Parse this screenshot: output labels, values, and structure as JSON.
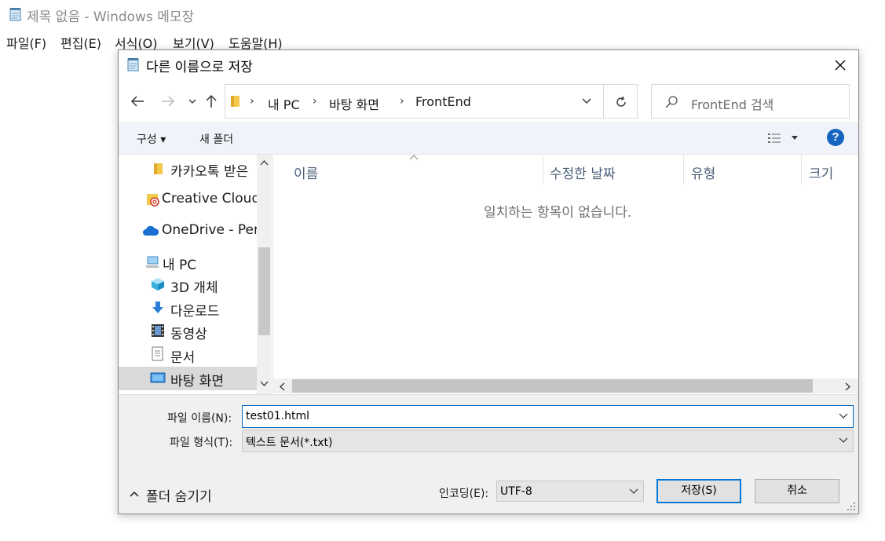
{
  "notepad": {
    "title": "제목 없음 - Windows 메모장",
    "menu": [
      "파일(F)",
      "편집(E)",
      "서식(O)",
      "보기(V)",
      "도움말(H)"
    ]
  },
  "dialog": {
    "title": "다른 이름으로 저장",
    "address": {
      "segments": [
        "내 PC",
        "바탕 화면",
        "FrontEnd"
      ]
    },
    "search_placeholder": "FrontEnd 검색",
    "toolbar": {
      "organize": "구성 ▾",
      "new_folder": "새 폴더",
      "help": "?"
    },
    "nav_items": [
      "카카오톡 받은",
      "Creative Cloud",
      "OneDrive - Per",
      "내 PC",
      "3D 개체",
      "다운로드",
      "동영상",
      "문서",
      "바탕 화면"
    ],
    "nav_selected": "바탕 화면",
    "columns": [
      "이름",
      "수정한 날짜",
      "유형",
      "크기"
    ],
    "empty_message": "일치하는 항목이 없습니다.",
    "filename_label": "파일 이름(N):",
    "filename_value": "test01.html",
    "filetype_label": "파일 형식(T):",
    "filetype_value": "텍스트 문서(*.txt)",
    "hide_folders": "폴더 숨기기",
    "encoding_label": "인코딩(E):",
    "encoding_value": "UTF-8",
    "save_button": "저장(S)",
    "cancel_button": "취소"
  },
  "colors": {
    "accent": "#0078d7",
    "selection": "#d9d9d9",
    "help": "#1565c0"
  }
}
